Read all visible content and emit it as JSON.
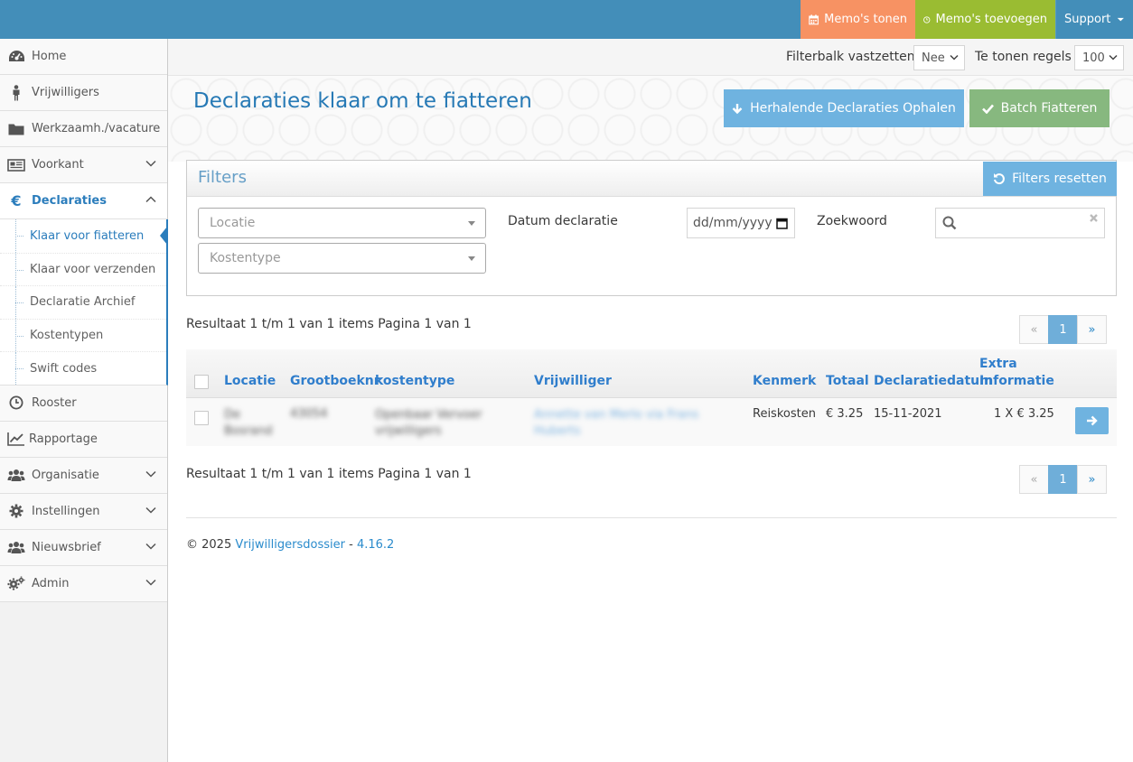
{
  "topbar": {
    "memo_show": "Memo's tonen",
    "memo_add": "Memo's toevoegen",
    "support": "Support",
    "colors": {
      "bar": "#438eb9",
      "memo_show": "#f79263",
      "memo_add": "#9abc32"
    }
  },
  "sidebar": {
    "items": [
      {
        "label": "Home",
        "icon": "dashboard-icon"
      },
      {
        "label": "Vrijwilligers",
        "icon": "person-icon"
      },
      {
        "label": "Werkzaamh./vacature",
        "icon": "folder-icon"
      },
      {
        "label": "Voorkant",
        "icon": "newspaper-icon"
      },
      {
        "label": "Declaraties",
        "icon": "euro-icon"
      },
      {
        "label": "Rooster",
        "icon": "clock-icon"
      },
      {
        "label": "Rapportage",
        "icon": "line-chart-icon"
      },
      {
        "label": "Organisatie",
        "icon": "users-icon"
      },
      {
        "label": "Instellingen",
        "icon": "gear-icon"
      },
      {
        "label": "Nieuwsbrief",
        "icon": "users-icon"
      },
      {
        "label": "Admin",
        "icon": "gears-icon"
      }
    ],
    "declaraties_sub": [
      "Klaar voor fiatteren",
      "Klaar voor verzenden",
      "Declaratie Archief",
      "Kostentypen",
      "Swift codes"
    ]
  },
  "toolbar": {
    "filterbar_label": "Filterbalk vastzetten",
    "filterbar_value": "Nee",
    "rows_label": "Te tonen regels",
    "rows_value": "100"
  },
  "page": {
    "title": "Declaraties klaar om te fiatteren",
    "btn_recurring": "Herhalende Declaraties Ophalen",
    "btn_batch": "Batch Fiatteren"
  },
  "filters": {
    "title": "Filters",
    "reset": "Filters resetten",
    "locatie_placeholder": "Locatie",
    "kostentype_placeholder": "Kostentype",
    "datum_label": "Datum declaratie",
    "datum_placeholder": "dd/mm/yyyy",
    "zoekwoord_label": "Zoekwoord"
  },
  "results": {
    "summary": "Resultaat 1 t/m 1 van 1 items Pagina 1 van 1",
    "pager": {
      "prev": "«",
      "current": "1",
      "next": "»"
    }
  },
  "table": {
    "headers": {
      "locatie": "Locatie",
      "grootboeknr": "Grootboeknr",
      "kostentype": "kostentype",
      "vrijwilliger": "Vrijwilliger",
      "kenmerk": "Kenmerk",
      "totaal": "Totaal",
      "declaratiedatum": "Declaratiedatum",
      "extra_1": "Extra",
      "extra_2": "Informatie"
    },
    "rows": [
      {
        "locatie": "De Bosrand",
        "grootboeknr": "43054",
        "kostentype": "Openbaar Vervoer vrijwilligers",
        "vrijwilliger": "Annette van Merlo via Frans Huberts",
        "kenmerk": "Reiskosten",
        "totaal": "€ 3.25",
        "declaratiedatum": "15-11-2021",
        "extra": "1 X € 3.25"
      }
    ]
  },
  "footer": {
    "copyright": "© 2025",
    "app": "Vrijwilligersdossier",
    "sep": "-",
    "version": "4.16.2"
  }
}
